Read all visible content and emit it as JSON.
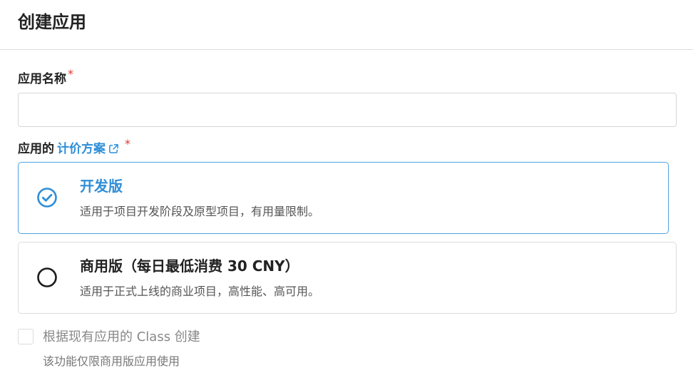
{
  "header": {
    "title": "创建应用"
  },
  "form": {
    "name_field": {
      "label": "应用名称",
      "required_mark": "*",
      "value": "",
      "placeholder": ""
    },
    "pricing_field": {
      "label_prefix": "应用的",
      "link_text": "计价方案",
      "link_icon": "external-link-icon",
      "required_mark": "*"
    },
    "plans": [
      {
        "title": "开发版",
        "description": "适用于项目开发阶段及原型项目，有用量限制。",
        "selected": true,
        "icon": "check-circle-icon"
      },
      {
        "title": "商用版（每日最低消费 30 CNY）",
        "description": "适用于正式上线的商业项目，高性能、高可用。",
        "selected": false,
        "icon": "radio-empty-icon"
      }
    ],
    "clone_option": {
      "label": "根据现有应用的 Class 创建",
      "hint": "该功能仅限商用版应用使用",
      "checked": false,
      "disabled": true
    }
  },
  "colors": {
    "accent": "#2e8ed8",
    "selected_border": "#4ea3e0",
    "required": "#e5352b",
    "border": "#dcdcdc"
  }
}
